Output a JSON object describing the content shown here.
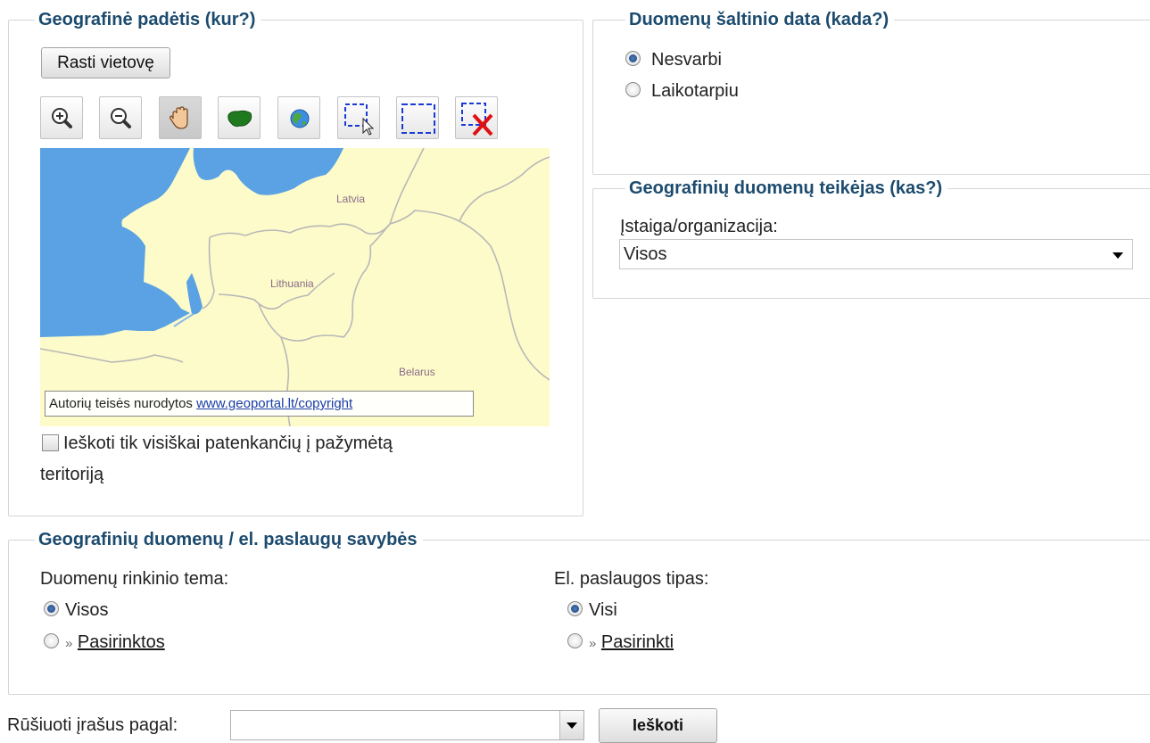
{
  "location": {
    "legend": "Geografinė padėtis (kur?)",
    "find_button": "Rasti vietovę",
    "toolbar": [
      {
        "name": "zoom-in-icon"
      },
      {
        "name": "zoom-out-icon"
      },
      {
        "name": "pan-hand-icon"
      },
      {
        "name": "lithuania-extent-icon"
      },
      {
        "name": "globe-icon"
      },
      {
        "name": "select-area-icon"
      },
      {
        "name": "draw-rectangle-icon"
      },
      {
        "name": "clear-selection-icon"
      }
    ],
    "map": {
      "labels": {
        "latvia": "Latvia",
        "lithuania": "Lithuania",
        "belarus": "Belarus"
      },
      "copyright_text": "Autorių teisės nurodytos",
      "copyright_link": "www.geoportal.lt/copyright",
      "colors": {
        "land": "#fdfbc9",
        "water": "#5aa2e3",
        "border": "#b8b8b8"
      }
    },
    "contained_only_label_line1": "Ieškoti tik visiškai patenkančių į pažymėtą",
    "contained_only_label_line2": "teritoriją",
    "contained_only_checked": false
  },
  "date": {
    "legend": "Duomenų šaltinio data (kada?)",
    "options": [
      {
        "label": "Nesvarbi",
        "selected": true
      },
      {
        "label": "Laikotarpiu",
        "selected": false
      }
    ]
  },
  "provider": {
    "legend": "Geografinių duomenų teikėjas (kas?)",
    "label": "Įstaiga/organizacija:",
    "value": "Visos"
  },
  "properties": {
    "legend": "Geografinių duomenų / el. paslaugų savybės",
    "theme": {
      "label": "Duomenų rinkinio tema:",
      "options": [
        {
          "label": "Visos",
          "selected": true
        },
        {
          "label": "Pasirinktos",
          "selected": false,
          "link": true
        }
      ]
    },
    "service_type": {
      "label": "El. paslaugos tipas:",
      "options": [
        {
          "label": "Visi",
          "selected": true
        },
        {
          "label": "Pasirinkti",
          "selected": false,
          "link": true
        }
      ]
    }
  },
  "sort": {
    "label": "Rūšiuoti įrašus pagal:",
    "value": ""
  },
  "search_button": "Ieškoti",
  "colors": {
    "legend_text": "#1c4b6e",
    "fieldset_border": "#d6d6d6"
  }
}
